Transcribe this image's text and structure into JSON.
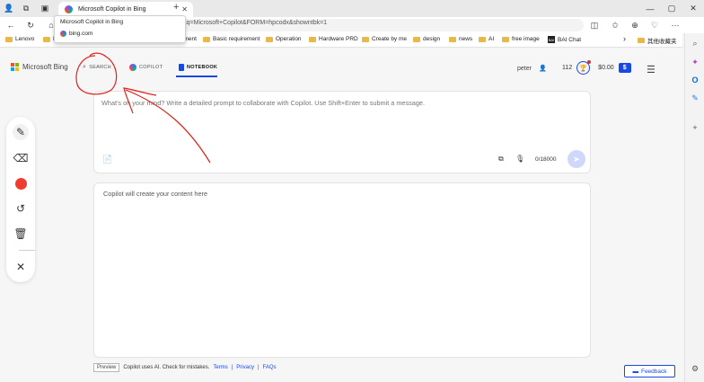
{
  "browser": {
    "tab_title": "Microsoft Copilot in Bing",
    "new_tab_symbol": "+",
    "url_visible": "&q=Microsoft+Copilot&FORM=hpcodx&showntbk=1",
    "tooltip": {
      "title": "Microsoft Copilot in Bing",
      "domain": "bing.com"
    },
    "bookmarks": [
      {
        "label": "Lenovo",
        "type": "folder"
      },
      {
        "label": "Dr",
        "type": "folder"
      },
      {
        "label": "",
        "type": "folder"
      },
      {
        "label": "",
        "type": "folder"
      },
      {
        "label": "management",
        "type": "folder"
      },
      {
        "label": "Basic requirement",
        "type": "folder"
      },
      {
        "label": "Operation",
        "type": "folder"
      },
      {
        "label": "Hardware PRD",
        "type": "folder"
      },
      {
        "label": "Create by me",
        "type": "folder"
      },
      {
        "label": "design",
        "type": "folder"
      },
      {
        "label": "news",
        "type": "folder"
      },
      {
        "label": "AI",
        "type": "folder"
      },
      {
        "label": "free image",
        "type": "folder"
      },
      {
        "label": "BAI Chat",
        "type": "site"
      }
    ],
    "bookmarks_overflow": "›",
    "other_favorites": "其他收藏夹"
  },
  "bing": {
    "logo_text": "Microsoft Bing",
    "nav": {
      "search": "SEARCH",
      "copilot": "COPILOT",
      "notebook": "NOTEBOOK"
    },
    "user_name": "peter",
    "points": "112",
    "balance": "$0.00",
    "balance_badge": "$",
    "prompt_placeholder": "What's on your mind? Write a detailed prompt to collaborate with Copilot. Use Shift+Enter to submit a message.",
    "char_counter": "0/18000",
    "output_placeholder": "Copilot will create your content here",
    "footer": {
      "preview_badge": "Preview",
      "disclaimer": "Copilot uses AI. Check for mistakes.",
      "terms": "Terms",
      "privacy": "Privacy",
      "faqs": "FAQs",
      "separator": "|"
    },
    "feedback_label": "Feedback"
  },
  "annotation": {
    "color": "#e0201b"
  }
}
